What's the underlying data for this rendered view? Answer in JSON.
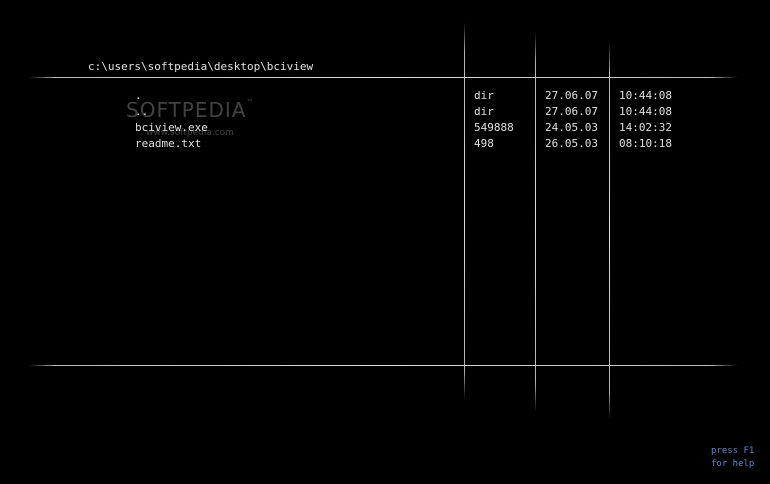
{
  "current_path": "c:\\users\\softpedia\\desktop\\bciview",
  "files": [
    {
      "name": ".",
      "size": "dir",
      "date": "27.06.07",
      "time": "10:44:08"
    },
    {
      "name": "..",
      "size": "dir",
      "date": "27.06.07",
      "time": "10:44:08"
    },
    {
      "name": "bciview.exe",
      "size": "549888",
      "date": "24.05.03",
      "time": "14:02:32"
    },
    {
      "name": "readme.txt",
      "size": "498",
      "date": "26.05.03",
      "time": "08:10:18"
    }
  ],
  "help": {
    "line1": "press F1",
    "line2": "for help"
  },
  "watermark": {
    "brand": "SOFTPEDIA",
    "tm": "™",
    "url": "www.softpedia.com"
  },
  "colors": {
    "background": "#000000",
    "text": "#e0e0e0",
    "help_text": "#5a86c8",
    "rules": "#dcdcdc"
  }
}
